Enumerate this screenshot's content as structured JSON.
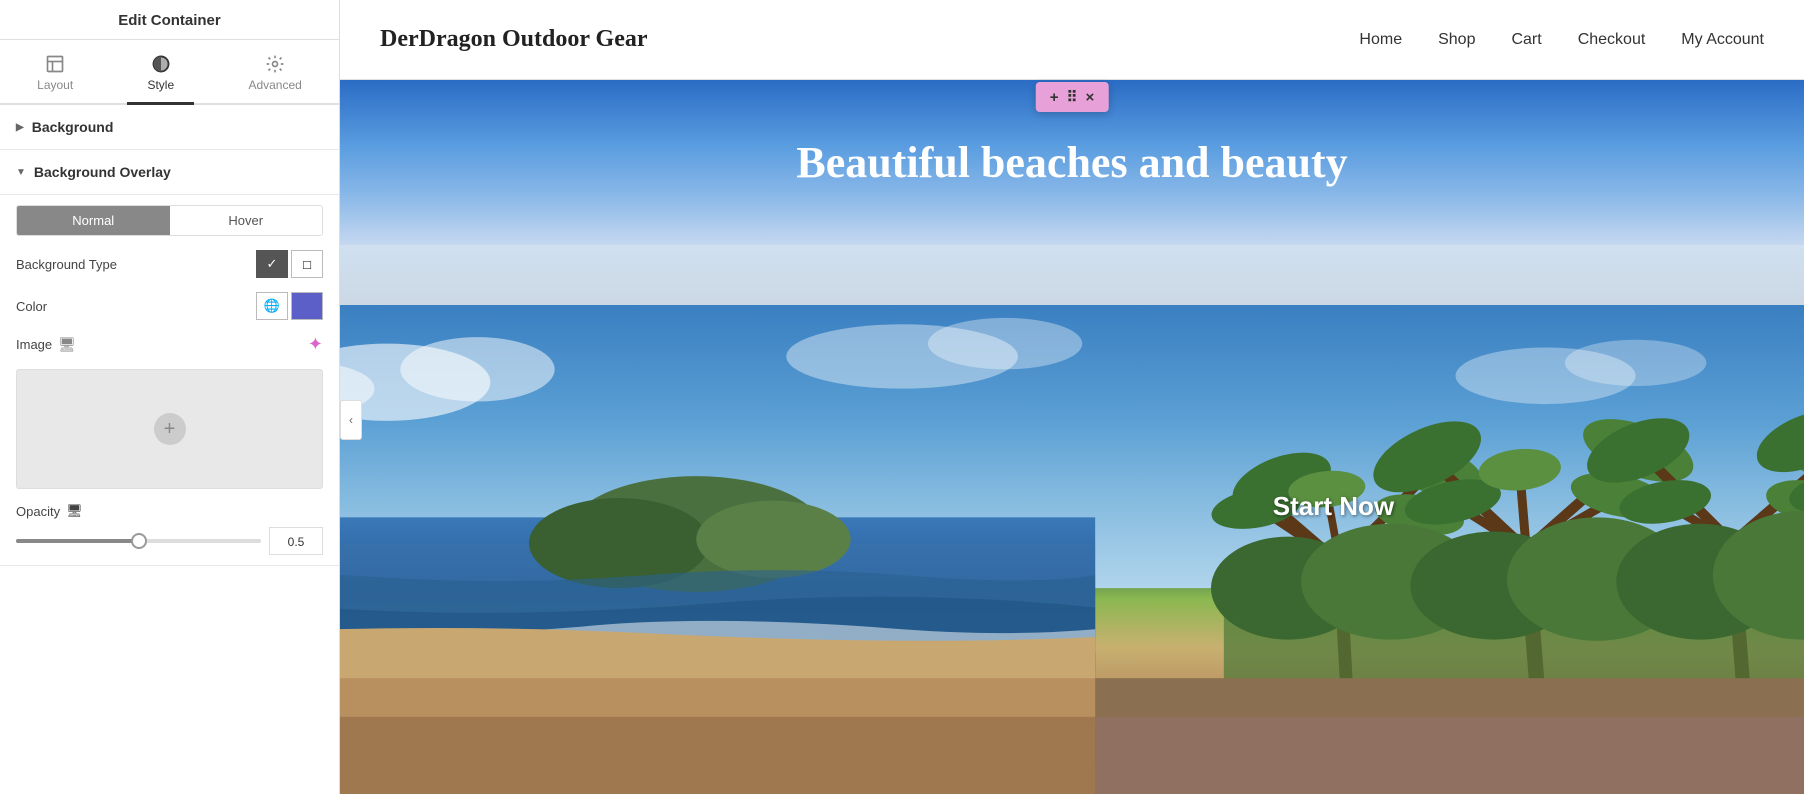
{
  "panel": {
    "title": "Edit Container",
    "tabs": [
      {
        "id": "layout",
        "label": "Layout",
        "icon": "layout"
      },
      {
        "id": "style",
        "label": "Style",
        "icon": "style"
      },
      {
        "id": "advanced",
        "label": "Advanced",
        "icon": "gear"
      }
    ],
    "active_tab": "style",
    "sections": {
      "background": {
        "label": "Background",
        "expanded": false
      },
      "background_overlay": {
        "label": "Background Overlay",
        "expanded": true,
        "state_tabs": [
          "Normal",
          "Hover"
        ],
        "active_state": "Normal",
        "fields": {
          "background_type": {
            "label": "Background Type",
            "options": [
              {
                "icon": "✓",
                "active": true
              },
              {
                "icon": "□",
                "active": false
              }
            ]
          },
          "color": {
            "label": "Color",
            "globe_icon": true,
            "color_value": "#5b5fc7"
          },
          "image": {
            "label": "Image",
            "monitor_icon": true,
            "ai_icon": true
          },
          "opacity": {
            "label": "Opacity",
            "monitor_icon": true,
            "value": "0.5",
            "slider_percent": 50
          }
        }
      }
    }
  },
  "site": {
    "logo": "DerDragon Outdoor Gear",
    "nav": [
      "Home",
      "Shop",
      "Cart",
      "Checkout",
      "My Account"
    ]
  },
  "toolbar": {
    "plus": "+",
    "move": "⠿",
    "close": "×"
  },
  "hero": {
    "title": "Beautiful beaches and beauty",
    "start_now": "Start Now"
  }
}
